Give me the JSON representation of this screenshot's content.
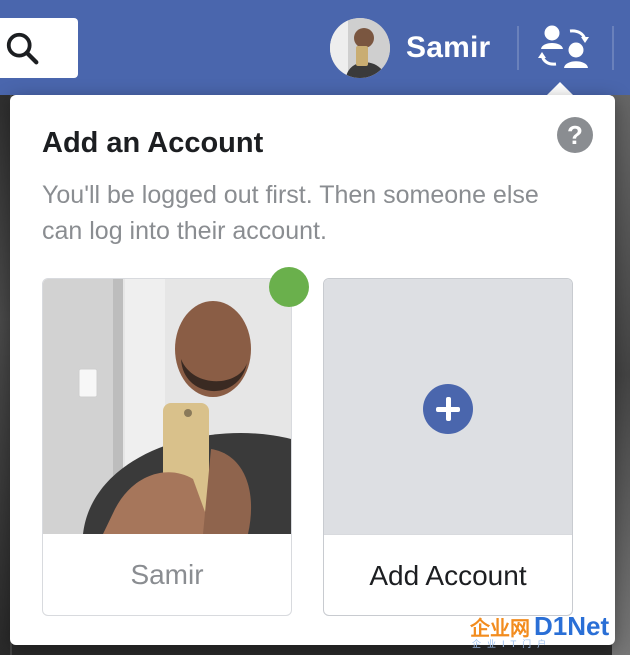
{
  "header": {
    "profile_name": "Samir"
  },
  "popover": {
    "title": "Add an Account",
    "subtitle": "You'll be logged out first. Then someone else can log into their account.",
    "help": "?",
    "cards": [
      {
        "label": "Samir",
        "online_status_color": "#6ab04c"
      },
      {
        "label": "Add Account"
      }
    ]
  },
  "colors": {
    "brand": "#4a66ad",
    "text_primary": "#1c1e21",
    "text_secondary": "#8a8d91",
    "online": "#6ab04c"
  },
  "icons": {
    "search": "search-icon",
    "account_switch": "switch-accounts-icon",
    "help": "help-icon",
    "add": "plus-icon"
  },
  "watermark": {
    "brand_left": "企业网",
    "brand_right": "D1Net",
    "tagline": "企业IT门户"
  }
}
